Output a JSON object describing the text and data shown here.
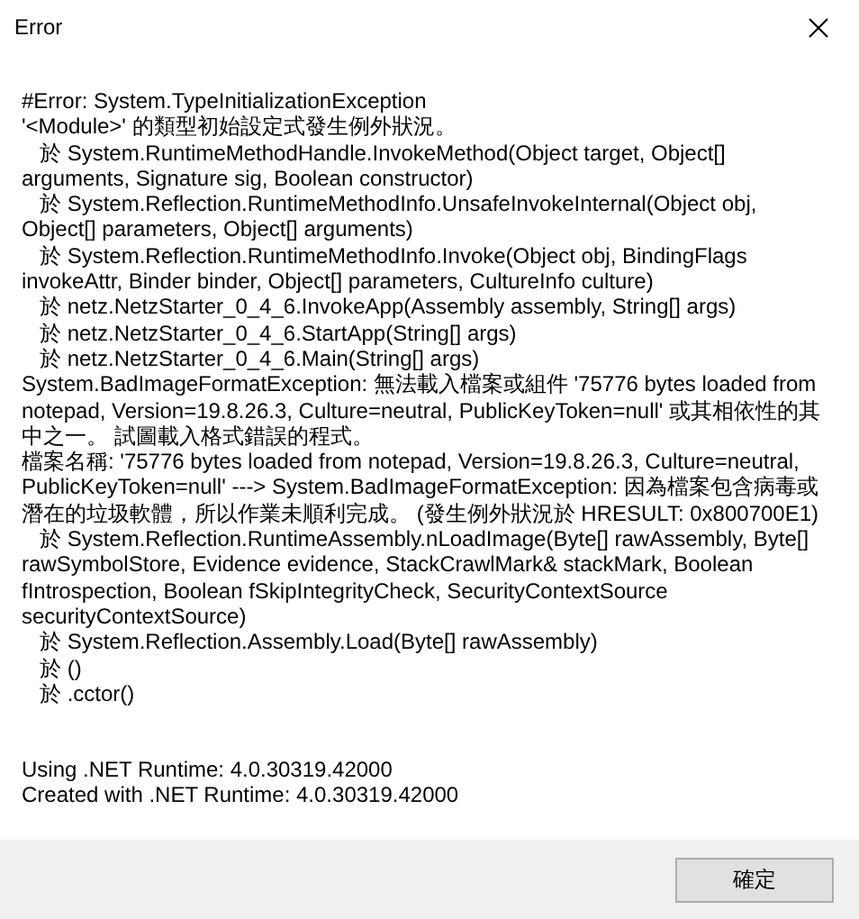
{
  "window": {
    "title": "Error"
  },
  "message": {
    "lines": [
      "#Error: System.TypeInitializationException",
      "'<Module>' 的類型初始設定式發生例外狀況。",
      "   於 System.RuntimeMethodHandle.InvokeMethod(Object target, Object[]",
      "arguments, Signature sig, Boolean constructor)",
      "   於 System.Reflection.RuntimeMethodInfo.UnsafeInvokeInternal(Object obj,",
      "Object[] parameters, Object[] arguments)",
      "   於 System.Reflection.RuntimeMethodInfo.Invoke(Object obj, BindingFlags",
      "invokeAttr, Binder binder, Object[] parameters, CultureInfo culture)",
      "   於 netz.NetzStarter_0_4_6.InvokeApp(Assembly assembly, String[] args)",
      "   於 netz.NetzStarter_0_4_6.StartApp(String[] args)",
      "   於 netz.NetzStarter_0_4_6.Main(String[] args)",
      "System.BadImageFormatException: 無法載入檔案或組件 '75776 bytes loaded from",
      "notepad, Version=19.8.26.3, Culture=neutral, PublicKeyToken=null' 或其相依性的其",
      "中之一。 試圖載入格式錯誤的程式。",
      "檔案名稱: '75776 bytes loaded from notepad, Version=19.8.26.3, Culture=neutral,",
      "PublicKeyToken=null' ---> System.BadImageFormatException: 因為檔案包含病毒或",
      "潛在的垃圾軟體，所以作業未順利完成。 (發生例外狀況於 HRESULT: 0x800700E1)",
      "   於 System.Reflection.RuntimeAssembly.nLoadImage(Byte[] rawAssembly, Byte[]",
      "rawSymbolStore, Evidence evidence, StackCrawlMark& stackMark, Boolean",
      "fIntrospection, Boolean fSkipIntegrityCheck, SecurityContextSource",
      "securityContextSource)",
      "   於 System.Reflection.Assembly.Load(Byte[] rawAssembly)",
      "   於 ()",
      "   於 .cctor()"
    ]
  },
  "runtime_info": {
    "lines": [
      "Using .NET Runtime: 4.0.30319.42000",
      "Created with .NET Runtime: 4.0.30319.42000"
    ]
  },
  "buttons": [
    "確定"
  ]
}
